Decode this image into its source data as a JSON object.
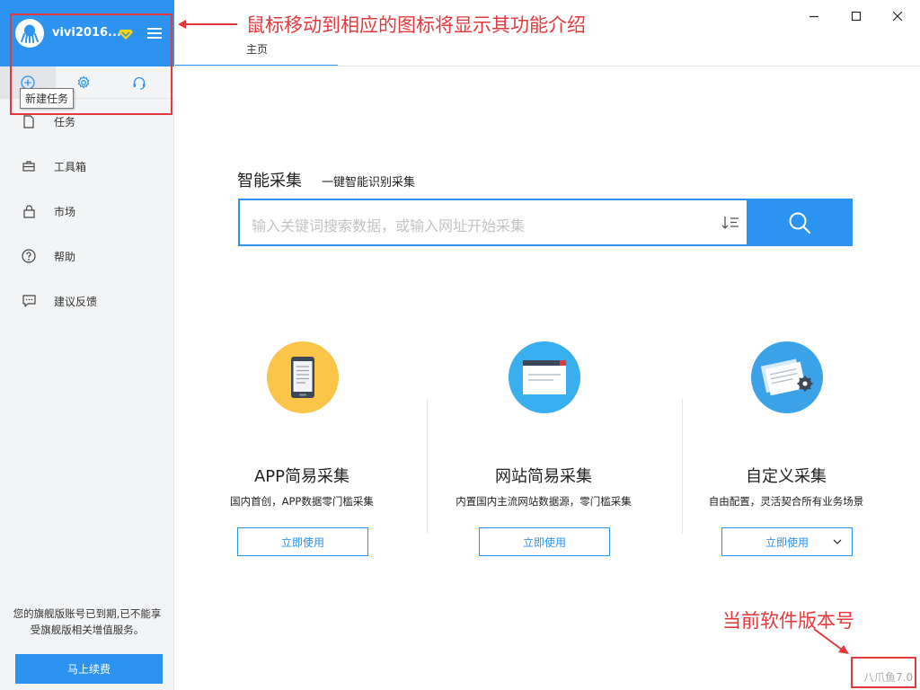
{
  "user": {
    "name": "vivi2016..."
  },
  "tooltip": {
    "new_task": "新建任务"
  },
  "nav": [
    {
      "label": "任务"
    },
    {
      "label": "工具箱"
    },
    {
      "label": "市场"
    },
    {
      "label": "帮助"
    },
    {
      "label": "建议反馈"
    }
  ],
  "expire_note": "您的旗舰版账号已到期,已不能享受旗舰版相关增值服务。",
  "renew_button": "马上续费",
  "annotations": {
    "top": "鼠标移动到相应的图标将显示其功能介绍",
    "bottom": "当前软件版本号"
  },
  "tabs": {
    "home": "主页"
  },
  "smart": {
    "title": "智能采集",
    "subtitle": "一键智能识别采集",
    "placeholder": "输入关键词搜索数据，或输入网址开始采集"
  },
  "features": [
    {
      "title": "APP简易采集",
      "desc": "国内首创，APP数据零门槛采集",
      "button": "立即使用"
    },
    {
      "title": "网站简易采集",
      "desc": "内置国内主流网站数据源，零门槛采集",
      "button": "立即使用"
    },
    {
      "title": "自定义采集",
      "desc": "自由配置，灵活契合所有业务场景",
      "button": "立即使用"
    }
  ],
  "version": "八爪鱼7.0",
  "colors": {
    "accent": "#2c93f0",
    "annotation": "#e4393c"
  }
}
